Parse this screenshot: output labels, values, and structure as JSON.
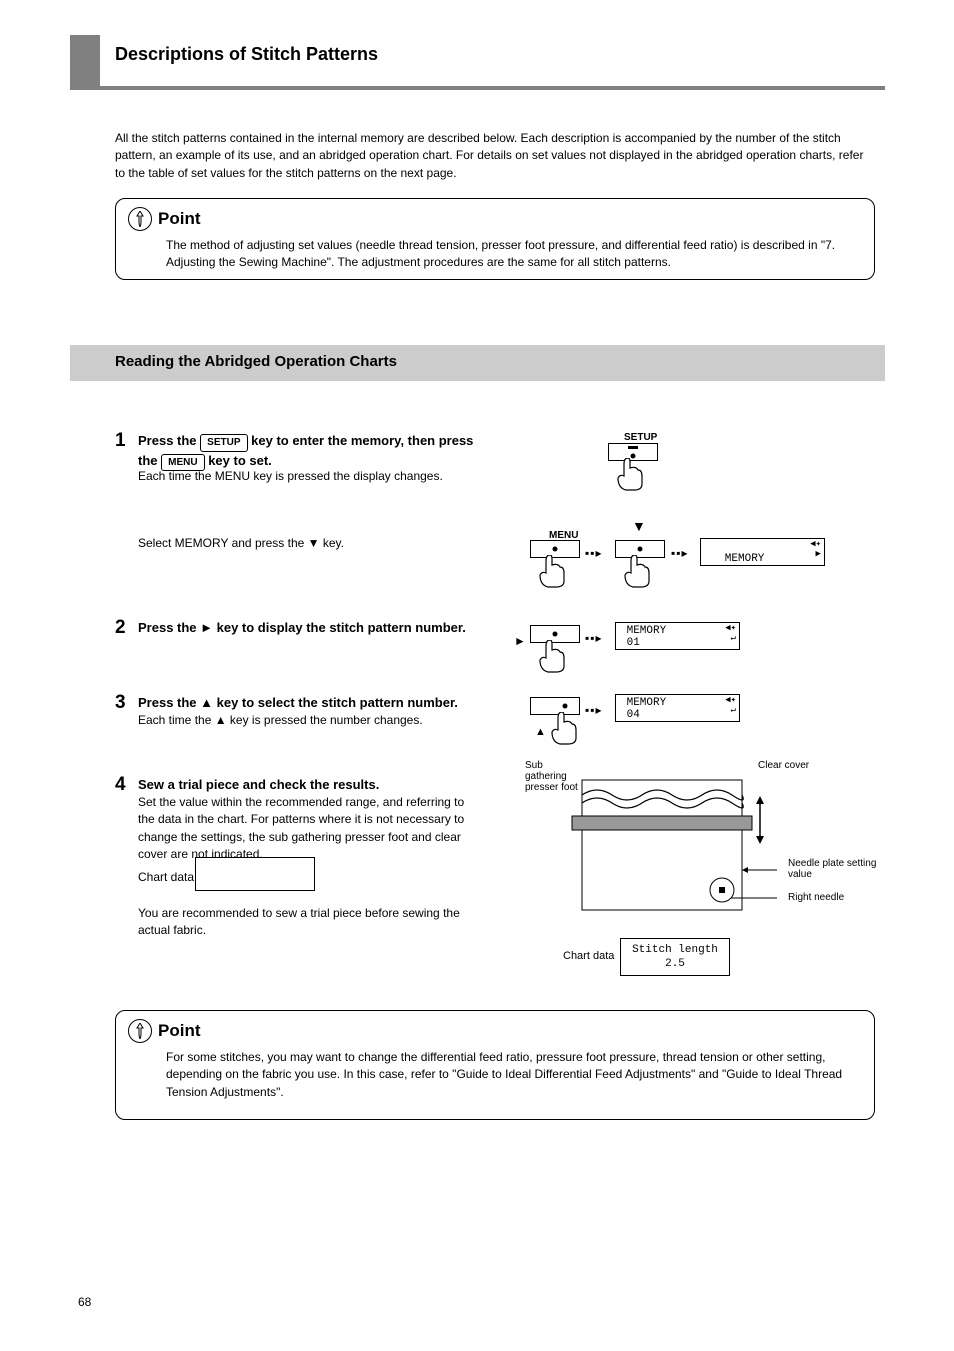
{
  "header": {
    "title": "Descriptions of Stitch Patterns"
  },
  "intro": "All the stitch patterns contained in the internal memory are described below. Each description is accompanied by the number of the stitch pattern, an example of its use, and an abridged operation chart. For details on set values not displayed in the abridged operation charts, refer to the table of set values for the stitch patterns on the next page.",
  "point1": {
    "label": "Point",
    "body": "The method of adjusting set values (needle thread tension, presser foot pressure, and differential feed ratio) is described in \"7. Adjusting the Sewing Machine\". The adjustment procedures are the same for all stitch patterns."
  },
  "section": {
    "title": "Reading the Abridged Operation Charts"
  },
  "steps": {
    "s1": {
      "num": "1",
      "head_line1": "Press the       key to enter the",
      "head_badge": "SETUP",
      "head_line2": "memory, then press",
      "head_line3": "the       key to set.",
      "head_menu": "MENU",
      "body": "Each time the MENU key is pressed the display changes.\nSelect MEMORY and press the ▼ key."
    },
    "s2": {
      "num": "2",
      "head": "Press the ► key to display the stitch pattern number."
    },
    "s3": {
      "num": "3",
      "head": "Press the ▲ key to select the stitch pattern number.",
      "body": "Each time the ▲ key is pressed the number changes."
    },
    "s4": {
      "num": "4",
      "head": "Sew a trial piece and check the results.",
      "body1": "Set the value within the recommended range, and referring to the data in the chart. For patterns where it is not necessary to change the settings, the sub gathering presser foot and clear cover are not indicated.",
      "body2": "You are recommended to sew a trial piece before sewing the actual fabric."
    }
  },
  "lcd": {
    "memory": {
      "l1": " MEMORY",
      "l2": "",
      "arrows": "◀✦\n ▶"
    },
    "pattern01": {
      "l1": " MEMORY",
      "l2": " 01",
      "arrows": "◀✦\n ↵"
    },
    "pattern04": {
      "l1": " MEMORY",
      "l2": " 04",
      "arrows": "◀✦\n ↵"
    }
  },
  "buttons": {
    "setup": "SETUP",
    "menu": "MENU"
  },
  "chart_data_label": "Chart data",
  "chart_data_box": {
    "l1": "Stitch length",
    "l2": "2.5"
  },
  "diagram": {
    "sub_gathering": "Sub gathering presser foot",
    "clear_cover": "Clear cover",
    "needle_plate": "Needle plate setting value",
    "right_needle": "Right needle"
  },
  "point2": {
    "label": "Point",
    "body": "For some stitches, you may want to change the differential feed ratio, pressure foot pressure, thread tension or other setting, depending on the fabric you use. In this case, refer to \"Guide to Ideal Differential Feed Adjustments\" and \"Guide to Ideal Thread Tension Adjustments\"."
  },
  "page": "68"
}
